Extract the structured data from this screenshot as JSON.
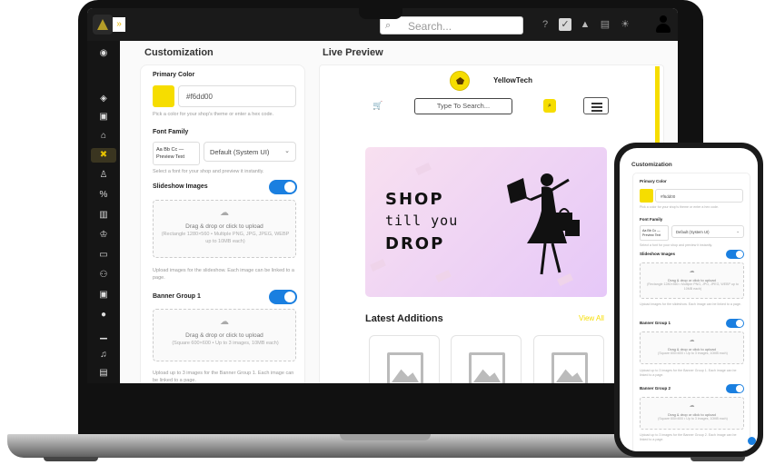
{
  "topbar": {
    "search_placeholder": "Search..."
  },
  "sidebar": {
    "items": [
      {
        "icon": "dashboard-icon"
      },
      {
        "icon": "layers-icon"
      },
      {
        "icon": "box-icon"
      },
      {
        "icon": "bag-icon"
      },
      {
        "icon": "customize-icon",
        "active": true
      },
      {
        "icon": "users-icon"
      },
      {
        "icon": "percent-icon"
      },
      {
        "icon": "coupon-icon"
      },
      {
        "icon": "crown-icon"
      },
      {
        "icon": "truck-icon"
      },
      {
        "icon": "network-icon"
      },
      {
        "icon": "wallet-icon"
      },
      {
        "icon": "apps-icon"
      },
      {
        "icon": "signal-icon"
      },
      {
        "icon": "bell-icon"
      },
      {
        "icon": "document-icon"
      }
    ]
  },
  "customization": {
    "title": "Customization",
    "primary_color": {
      "label": "Primary Color",
      "value": "#f6dd00",
      "help": "Pick a color for your shop's theme or enter a hex code."
    },
    "font_family": {
      "label": "Font Family",
      "preview": "Aa Bb Cc — Preview Text",
      "selected": "Default (System UI)",
      "help": "Select a font for your shop and preview it instantly."
    },
    "slideshow": {
      "label": "Slideshow Images",
      "enabled": true,
      "drop_title": "Drag & drop or click to upload",
      "drop_hint": "(Rectangle 1280×560 • Multiple PNG, JPG, JPEG, WEBP up to 10MB each)",
      "help": "Upload images for the slideshow. Each image can be linked to a page."
    },
    "banner_group_1": {
      "label": "Banner Group 1",
      "enabled": true,
      "drop_title": "Drag & drop or click to upload",
      "drop_hint": "(Square 600×600 • Up to 3 images, 10MB each)",
      "help": "Upload up to 3 images for the Banner Group 1. Each image can be linked to a page."
    }
  },
  "preview": {
    "title": "Live Preview",
    "brand": "YellowTech",
    "search_placeholder": "Type To Search...",
    "banner": {
      "line1": "SHOP",
      "line2": "till you",
      "line3": "DROP"
    },
    "latest_title": "Latest Additions",
    "view_all": "View All"
  },
  "phone": {
    "title": "Customization",
    "primary_color_label": "Primary Color",
    "primary_color_value": "#f6dd00",
    "primary_color_help": "Pick a color for your shop's theme or enter a hex code.",
    "font_family_label": "Font Family",
    "font_preview": "Aa Bb Cc — Preview Text",
    "font_selected": "Default (System UI)",
    "font_help": "Select a font for your shop and preview it instantly.",
    "slideshow_label": "Slideshow Images",
    "slideshow_drop_title": "Drag & drop or click to upload",
    "slideshow_drop_hint": "(Rectangle 1280×560 • Multiple PNG, JPG, JPEG, WEBP up to 10MB each)",
    "slideshow_help": "Upload images for the slideshow. Each image can be linked to a page.",
    "banner1_label": "Banner Group 1",
    "banner1_drop_title": "Drag & drop or click to upload",
    "banner1_drop_hint": "(Square 600×600 • Up to 3 images, 10MB each)",
    "banner1_help": "Upload up to 3 images for the Banner Group 1. Each image can be linked to a page.",
    "banner2_label": "Banner Group 2",
    "banner2_drop_title": "Drag & drop or click to upload",
    "banner2_drop_hint": "(Square 600×600 • Up to 3 images, 10MB each)",
    "banner2_help": "Upload up to 3 images for the Banner Group 2. Each image can be linked to a page."
  },
  "colors": {
    "accent": "#f6dd00",
    "toggle": "#1a7fe0",
    "sidebar_bg": "#151515"
  }
}
